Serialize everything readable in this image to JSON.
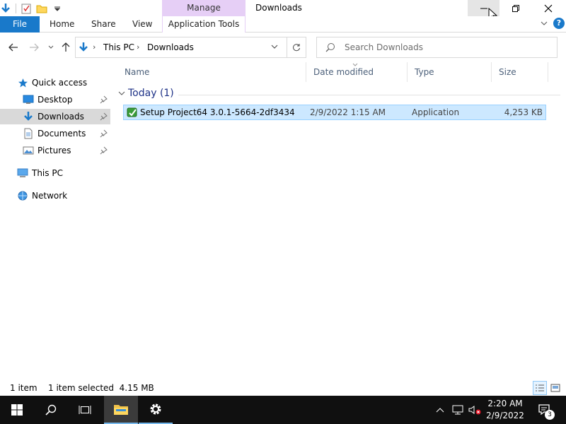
{
  "window": {
    "title": "Downloads",
    "context_tab": "Manage",
    "colors": {
      "file_tab": "#1979ca",
      "context_tab": "#e6cff6",
      "selection": "#cce8ff",
      "taskbar": "#101010"
    }
  },
  "ribbon": {
    "file_label": "File",
    "tabs": [
      "Home",
      "Share",
      "View"
    ],
    "app_tools_label": "Application Tools"
  },
  "address": {
    "crumbs": [
      "This PC",
      "Downloads"
    ],
    "search_placeholder": "Search Downloads"
  },
  "nav": {
    "quick_access": "Quick access",
    "items": [
      {
        "label": "Desktop",
        "icon": "desktop-icon",
        "pinned": true
      },
      {
        "label": "Downloads",
        "icon": "downloads-icon",
        "pinned": true
      },
      {
        "label": "Documents",
        "icon": "documents-icon",
        "pinned": true
      },
      {
        "label": "Pictures",
        "icon": "pictures-icon",
        "pinned": true
      }
    ],
    "this_pc": "This PC",
    "network": "Network"
  },
  "columns": {
    "name": "Name",
    "date": "Date modified",
    "type": "Type",
    "size": "Size"
  },
  "group": {
    "title": "Today (1)"
  },
  "files": [
    {
      "name": "Setup Project64 3.0.1-5664-2df3434",
      "date": "2/9/2022 1:15 AM",
      "type": "Application",
      "size": "4,253 KB"
    }
  ],
  "status": {
    "count": "1 item",
    "selection": "1 item selected  4.15 MB"
  },
  "taskbar": {
    "time": "2:20 AM",
    "date": "2/9/2022",
    "notification_count": "3"
  }
}
